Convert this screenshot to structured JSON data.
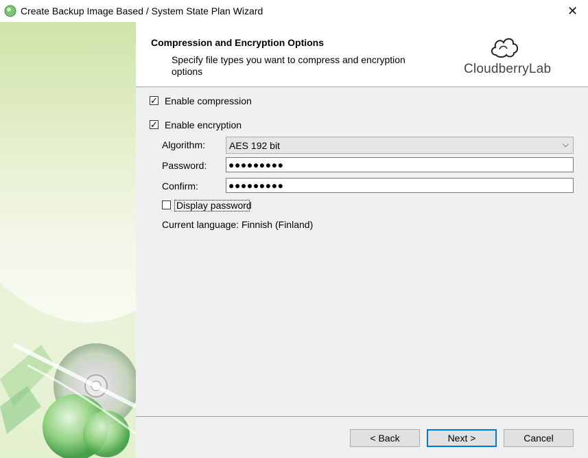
{
  "window": {
    "title": "Create Backup Image Based / System State Plan Wizard",
    "close_glyph": "✕",
    "icon": "cloudberry-app-icon"
  },
  "header": {
    "title": "Compression and Encryption Options",
    "subtitle": "Specify file types you want to compress and encryption options",
    "logo_text": "CloudberryLab"
  },
  "options": {
    "enable_compression": {
      "label": "Enable compression",
      "checked": true
    },
    "enable_encryption": {
      "label": "Enable encryption",
      "checked": true
    },
    "algorithm": {
      "label": "Algorithm:",
      "value": "AES 192 bit"
    },
    "password": {
      "label": "Password:",
      "value": "●●●●●●●●●"
    },
    "confirm": {
      "label": "Confirm:",
      "value": "●●●●●●●●●"
    },
    "display_password": {
      "label": "Display password",
      "checked": false
    },
    "current_language": "Current language: Finnish (Finland)"
  },
  "buttons": {
    "back": "< Back",
    "next": "Next >",
    "cancel": "Cancel"
  },
  "colors": {
    "accent": "#0078d7",
    "banner_green": "#cfe3a8"
  }
}
